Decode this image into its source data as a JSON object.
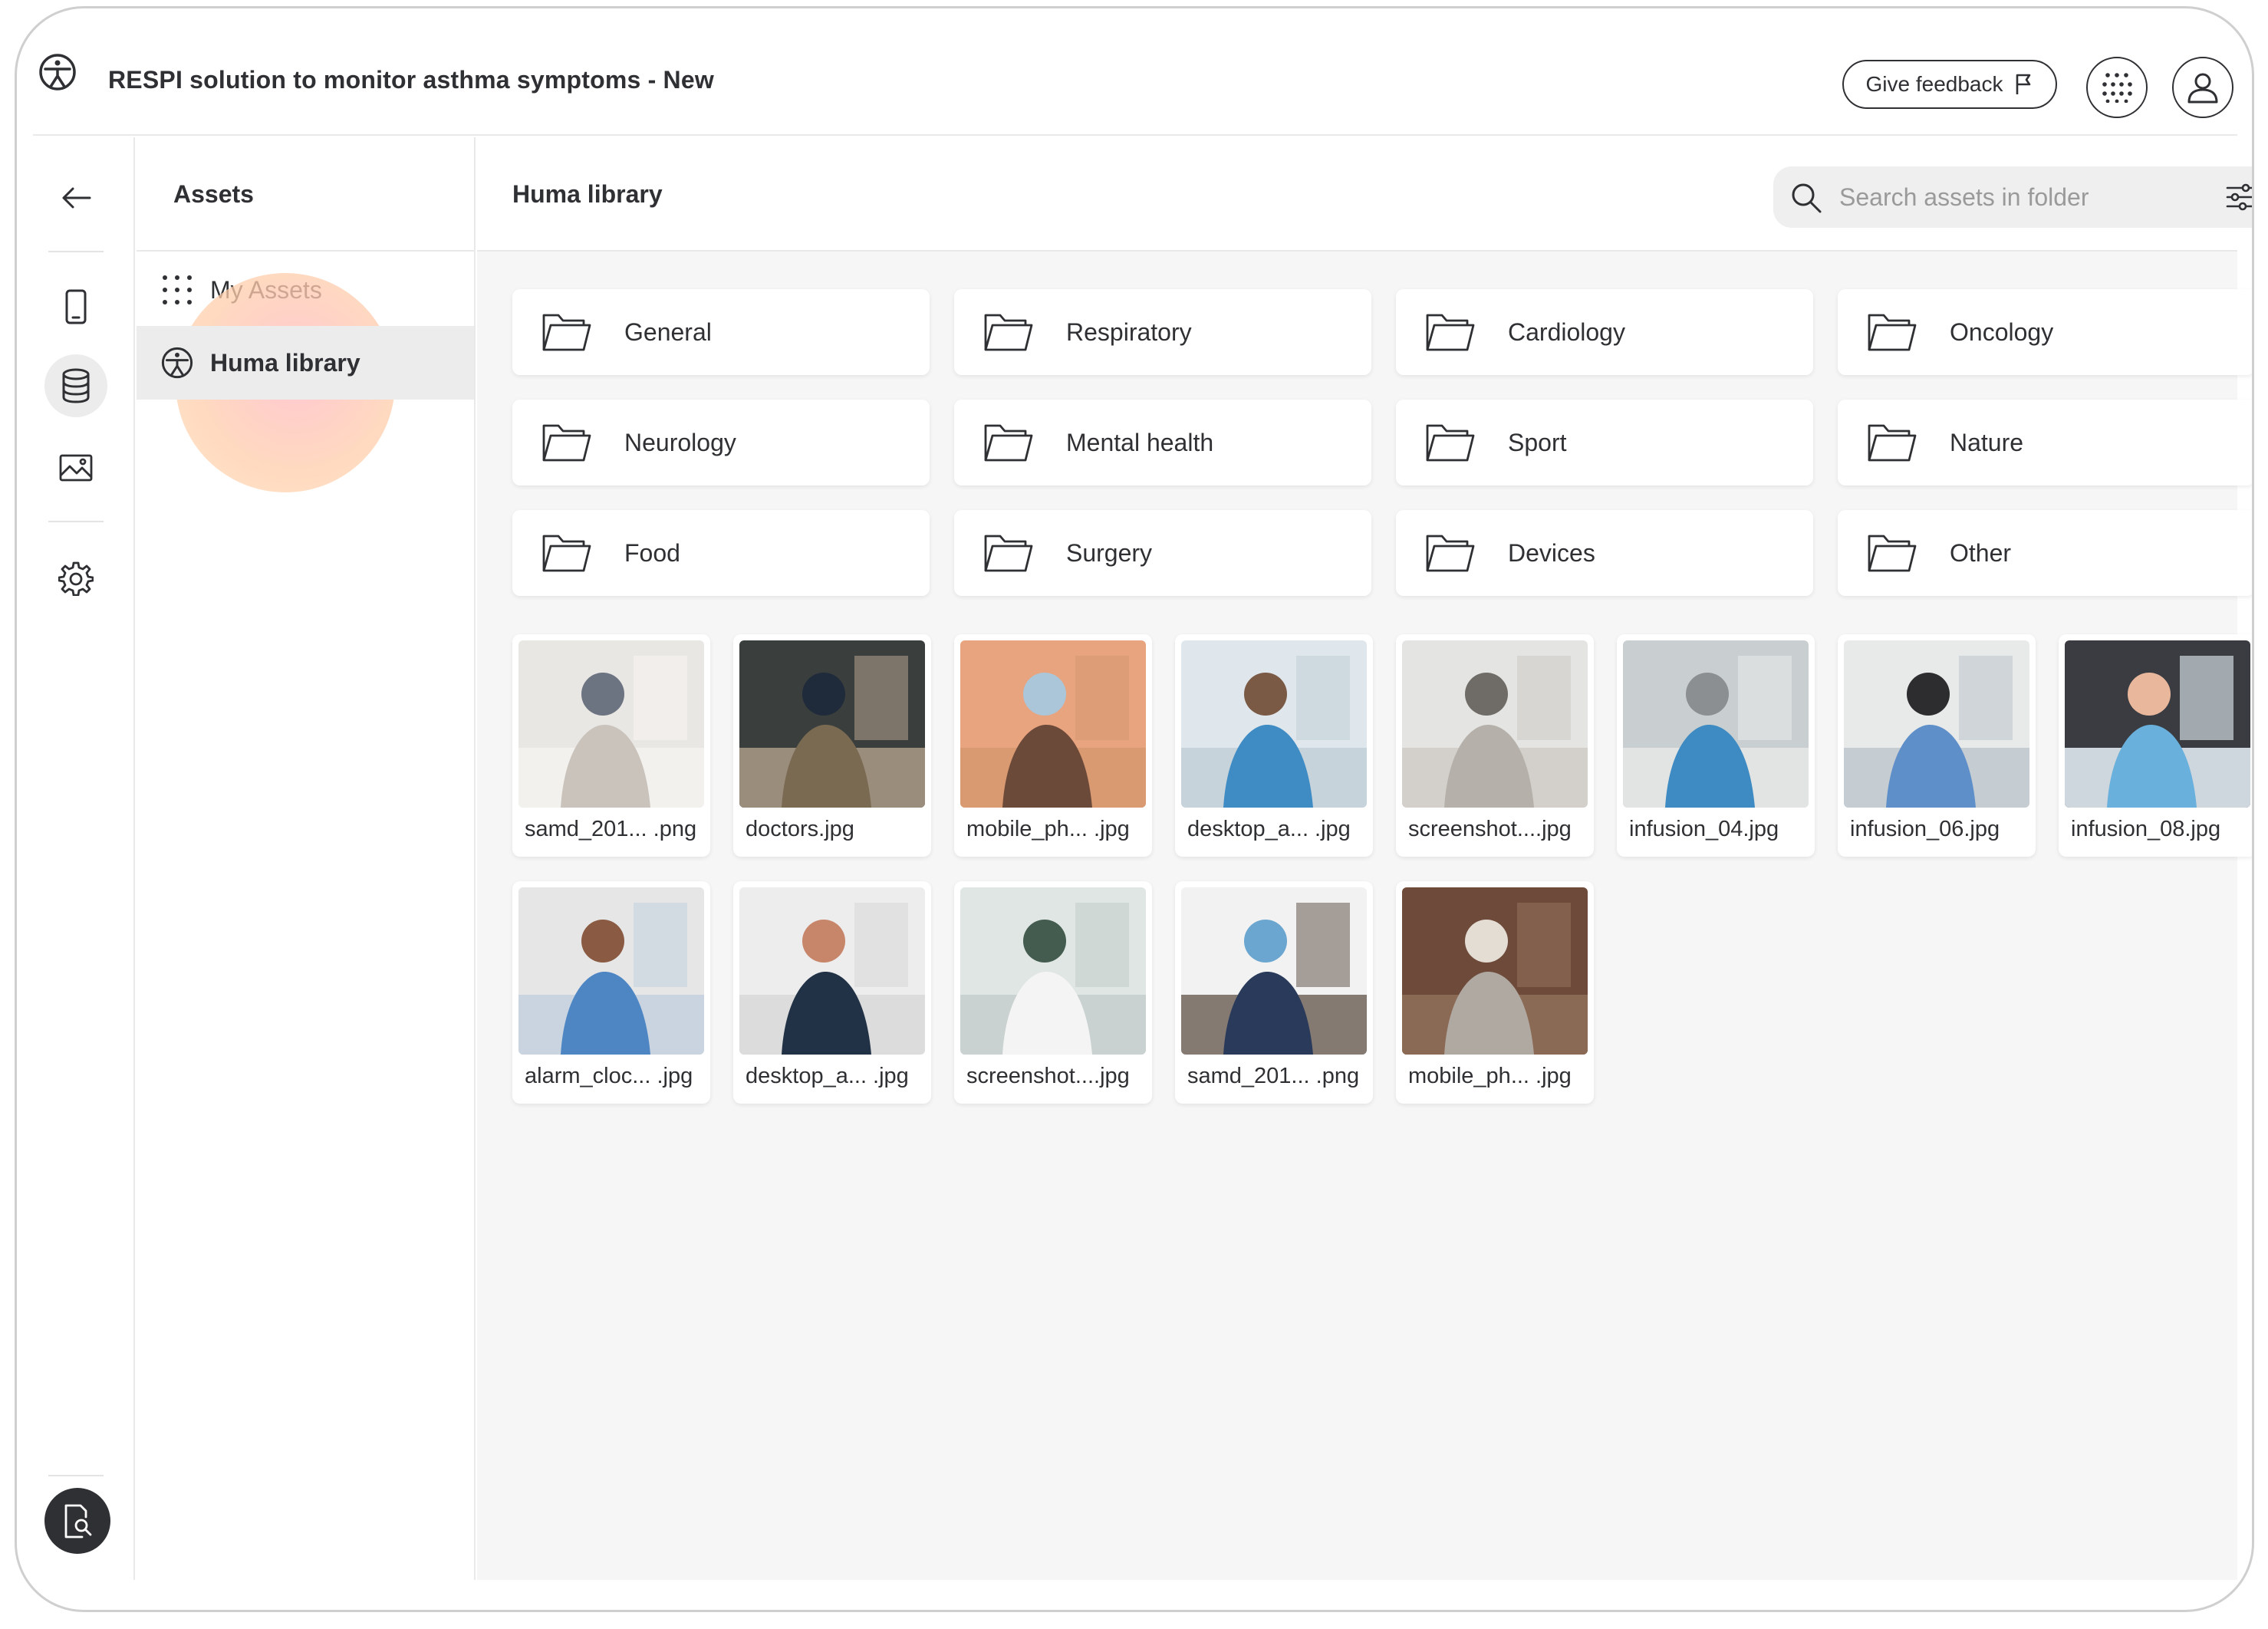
{
  "header": {
    "title": "RESPI solution to monitor asthma symptoms - New",
    "feedback_label": "Give feedback"
  },
  "sidebar": {
    "title": "Assets",
    "items": [
      {
        "label": "My Assets",
        "icon": "dots-grid-icon",
        "active": false
      },
      {
        "label": "Huma library",
        "icon": "huma-logo-icon",
        "active": true
      }
    ]
  },
  "main": {
    "title": "Huma library",
    "search_placeholder": "Search assets in folder",
    "folders": [
      "General",
      "Respiratory",
      "Cardiology",
      "Oncology",
      "Neurology",
      "Mental health",
      "Sport",
      "Nature",
      "Food",
      "Surgery",
      "Devices",
      "Other"
    ],
    "assets": [
      {
        "name": "samd_201... .png",
        "palette": [
          "#e9e7e4",
          "#c9c3bc",
          "#6d7481",
          "#f3f1ee"
        ]
      },
      {
        "name": "doctors.jpg",
        "palette": [
          "#3a3f3d",
          "#7a6a52",
          "#1f2a3a",
          "#9a8d7c"
        ]
      },
      {
        "name": "mobile_ph... .jpg",
        "palette": [
          "#e8a47f",
          "#6c4a3a",
          "#aac6d8",
          "#d99a72"
        ]
      },
      {
        "name": "desktop_a... .jpg",
        "palette": [
          "#dfe7ec",
          "#3f8bc4",
          "#7a5a45",
          "#c7d3db"
        ]
      },
      {
        "name": "screenshot....jpg",
        "palette": [
          "#e4e4e2",
          "#b5b1aa",
          "#6f6c68",
          "#d3d0cc"
        ]
      },
      {
        "name": "infusion_04.jpg",
        "palette": [
          "#c9cfd0",
          "#3d8bc2",
          "#8c8f92",
          "#e2e4e4"
        ]
      },
      {
        "name": "infusion_06.jpg",
        "palette": [
          "#e8eaea",
          "#5e8fc9",
          "#2d2d2f",
          "#c5ccd2"
        ]
      },
      {
        "name": "infusion_08.jpg",
        "palette": [
          "#3b3c41",
          "#6ab0dc",
          "#e9b79c",
          "#cfd7de"
        ]
      },
      {
        "name": "alarm_cloc... .jpg",
        "palette": [
          "#e6e6e6",
          "#4e86c3",
          "#8a5a42",
          "#c9d4e0"
        ]
      },
      {
        "name": "desktop_a... .jpg",
        "palette": [
          "#ededee",
          "#213246",
          "#c7856a",
          "#dcdcdc"
        ]
      },
      {
        "name": "screenshot....jpg",
        "palette": [
          "#dfe6e4",
          "#f4f4f4",
          "#445c4f",
          "#c9d2d0"
        ]
      },
      {
        "name": "samd_201... .png",
        "palette": [
          "#f2f2f2",
          "#2a3a5a",
          "#6aa6cf",
          "#857a72"
        ]
      },
      {
        "name": "mobile_ph... .jpg",
        "palette": [
          "#6d4a3a",
          "#b0a9a2",
          "#e4ddd4",
          "#8b6a55"
        ]
      }
    ]
  },
  "icons": {
    "back": "arrow-left-icon",
    "rail": [
      "phone-icon",
      "database-icon",
      "image-icon",
      "gear-icon"
    ],
    "bottom": "document-search-icon",
    "apps": "apps-grid-icon",
    "profile": "user-icon",
    "flag": "flag-icon",
    "search": "search-icon",
    "filter": "filter-sliders-icon"
  },
  "colors": {
    "text": "#2f3033",
    "active_bg": "#ececec",
    "content_bg": "#f6f6f6"
  }
}
